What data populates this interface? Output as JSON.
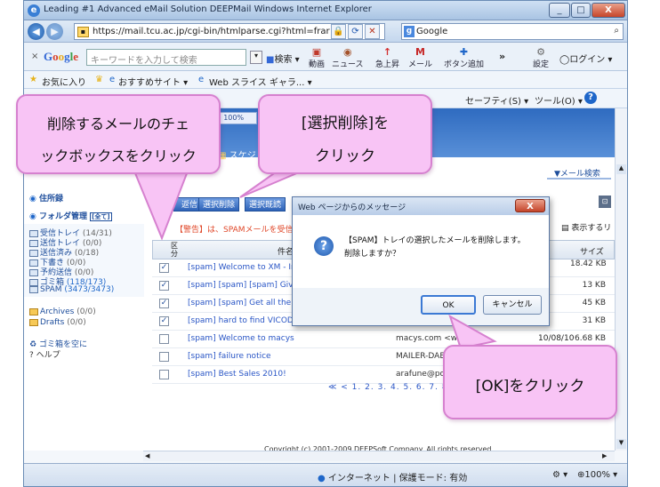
{
  "window": {
    "title": "Leading #1 Advanced eMail Solution   DEEPMail   Windows Internet Explorer",
    "controls": [
      "_",
      "□",
      "X"
    ]
  },
  "address_bar": {
    "url": "https://mail.tcu.ac.jp/cgi-bin/htmlparse.cgi?html=frar",
    "search_engine": "Google"
  },
  "google_toolbar": {
    "close": "×",
    "logo": "Google",
    "search_placeholder": "キーワードを入力して検索",
    "search_label": "検索",
    "buttons": [
      "動画",
      "ニュース",
      "急上昇",
      "メール",
      "ボタン追加"
    ],
    "more": "»",
    "settings": "設定",
    "login": "ログイン"
  },
  "favorites_bar": {
    "favorites": "お気に入り",
    "recommended": "おすすめサイト ▾",
    "webslice": "Web スライス ギャラ... ▾"
  },
  "command_bar": {
    "safety": "セーフティ(S) ▾",
    "tools": "ツール(O) ▾",
    "help": "?"
  },
  "mail": {
    "header_tabs": [
      "100%",
      "スケジ"
    ],
    "search_link": "▼メール検索",
    "sidebar": {
      "address_book": "住所録",
      "folder_manage": "フォルダ管理",
      "folder_manage_badge": "[全て]",
      "folders": [
        {
          "name": "受信トレイ",
          "count": "(14/31)"
        },
        {
          "name": "送信トレイ",
          "count": "(0/0)"
        },
        {
          "name": "送信済み",
          "count": "(0/18)"
        },
        {
          "name": "下書き",
          "count": "(0/0)"
        },
        {
          "name": "予約送信",
          "count": "(0/0)"
        },
        {
          "name": "ゴミ箱",
          "count": "(118/173)"
        },
        {
          "name": "SPAM",
          "count": "(3473/3473)"
        }
      ],
      "extra_folders": [
        {
          "name": "Archives",
          "count": "(0/0)"
        },
        {
          "name": "Drafts",
          "count": "(0/0)"
        }
      ],
      "empty_trash": "ゴミ箱を空に",
      "help": "? ヘルプ"
    },
    "toolbar_buttons": [
      "返信",
      "選択削除",
      "選択既読"
    ],
    "warning": "【警告】は、SPAMメールを受信トレイ",
    "display_link": "表示するリ",
    "list_header": {
      "mark": "区分",
      "subject": "件名",
      "size": "サイズ"
    },
    "rows": [
      {
        "checked": true,
        "subject": "[spam] Welcome to XM - Impo",
        "from": "",
        "size": "18.42 KB"
      },
      {
        "checked": true,
        "subject": "[spam] [spam] [spam] Give you",
        "from": "",
        "size": "13 KB"
      },
      {
        "checked": true,
        "subject": "[spam] [spam] Get all the blin",
        "from": "",
        "size": "45 KB"
      },
      {
        "checked": true,
        "subject": "[spam] hard to find VICODIN 8",
        "from": "",
        "size": "31 KB"
      },
      {
        "checked": false,
        "subject": "[spam] Welcome to macys",
        "from": "macys.com <welcome",
        "date": "10/08/10",
        "size": "6.68 KB"
      },
      {
        "checked": false,
        "subject": "[spam] failure notice",
        "from": "MAILER-DAE",
        "size": ""
      },
      {
        "checked": false,
        "subject": "[spam] Best Sales 2010!",
        "from": "arafune@po.",
        "size": ""
      }
    ],
    "pagination": "≪ < 1. 2. 3. 4. 5. 6. 7. 8",
    "copyright": "Copyright (c) 2001-2009 DEEPSoft Company. All rights reserved."
  },
  "dialog": {
    "title": "Web ページからのメッセージ",
    "close": "X",
    "message_line1": "【SPAM】トレイの選択したメールを削除します。",
    "message_line2": "削除しますか？",
    "ok": "OK",
    "cancel": "キャンセル"
  },
  "status_bar": {
    "zone": "インターネット | 保護モード: 有効",
    "zoom": "100%"
  },
  "callouts": {
    "checkbox_line1": "削除するメールのチェ",
    "checkbox_line2": "ックボックスをクリック",
    "delete_line1": "[選択削除]を",
    "delete_line2": "クリック",
    "ok": "[OK]をクリック"
  },
  "colors": {
    "callout_fill": "#f8c4f5",
    "callout_border": "#d681cf",
    "header_blue": "#2f6bc0",
    "spam_link": "#2a56c6"
  }
}
